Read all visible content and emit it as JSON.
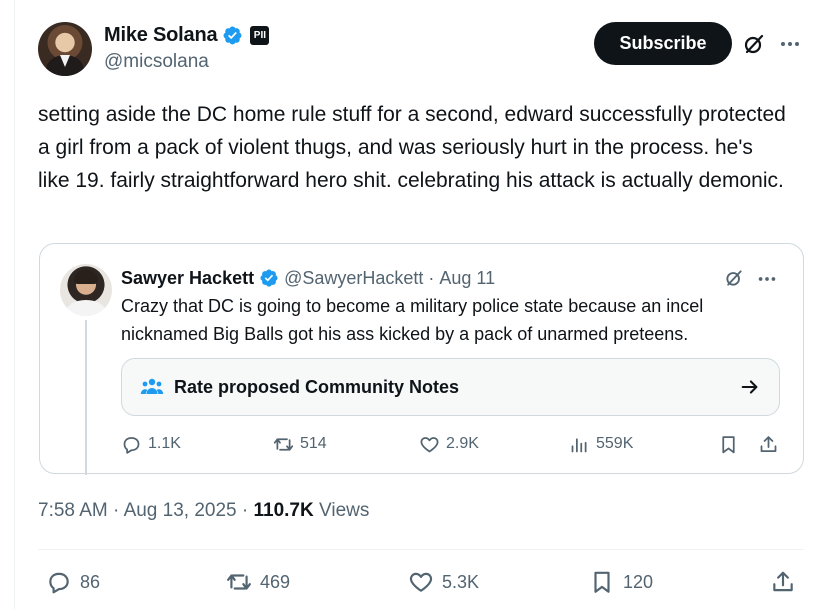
{
  "author": {
    "display_name": "Mike Solana",
    "handle": "@micsolana",
    "affiliation_badge": "PII"
  },
  "header": {
    "subscribe_label": "Subscribe",
    "grok_icon": "grok-icon",
    "more_icon": "more-icon"
  },
  "tweet": {
    "text": "setting aside the DC home rule stuff for a second, edward successfully protected a girl from a pack of violent thugs, and was seriously hurt in the process. he's like 19. fairly straightforward hero shit. celebrating his attack is actually demonic."
  },
  "quote": {
    "display_name": "Sawyer Hackett",
    "handle": "@SawyerHackett",
    "separator": "·",
    "date": "Aug 11",
    "text": "Crazy that DC is going to become a military police state because an incel nicknamed Big Balls got his ass kicked by a pack of unarmed preteens.",
    "notes_label": "Rate proposed Community Notes",
    "stats": {
      "replies": "1.1K",
      "reposts": "514",
      "likes": "2.9K",
      "views": "559K"
    }
  },
  "meta": {
    "time": "7:58 AM",
    "separator": "·",
    "date": "Aug 13, 2025",
    "separator2": "·",
    "views_count": "110.7K",
    "views_label": "Views"
  },
  "stats": {
    "replies": "86",
    "reposts": "469",
    "likes": "5.3K",
    "bookmarks": "120"
  },
  "colors": {
    "text": "#0f1419",
    "secondary": "#536471",
    "verified": "#1d9bf0",
    "border": "#cfd9de"
  }
}
